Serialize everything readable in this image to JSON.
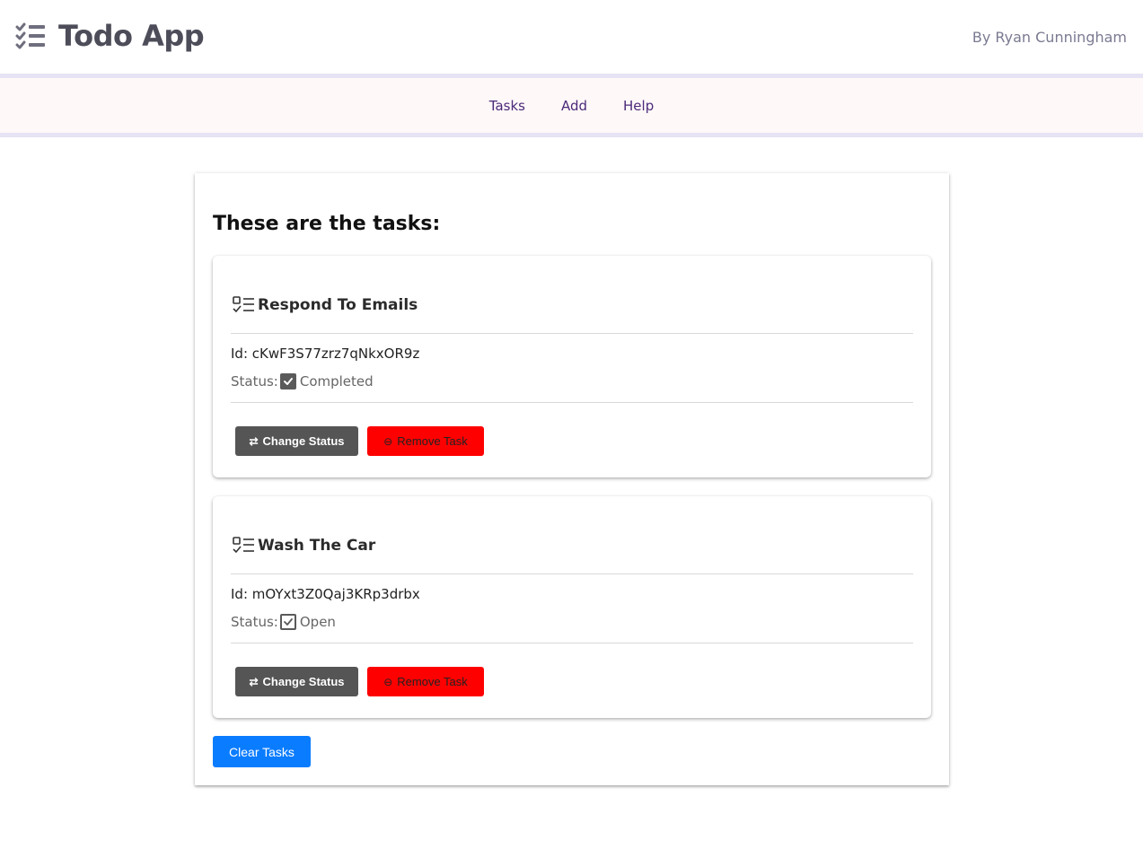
{
  "header": {
    "title": "Todo App",
    "author": "By Ryan Cunningham",
    "logo_icon": "checklist-icon"
  },
  "nav": {
    "items": [
      {
        "label": "Tasks"
      },
      {
        "label": "Add"
      },
      {
        "label": "Help"
      }
    ]
  },
  "main": {
    "heading": "These are the tasks:",
    "tasks": [
      {
        "name": "Respond To Emails",
        "id_label": "Id:",
        "id": "cKwF3S77zrz7qNkxOR9z",
        "status_label": "Status:",
        "status": "Completed",
        "status_icon": "checked-box-icon",
        "change_label": "Change Status",
        "remove_label": "Remove Task"
      },
      {
        "name": "Wash The Car",
        "id_label": "Id:",
        "id": "mOYxt3Z0Qaj3KRp3drbx",
        "status_label": "Status:",
        "status": "Open",
        "status_icon": "unchecked-box-icon",
        "change_label": "Change Status",
        "remove_label": "Remove Task"
      }
    ],
    "clear_label": "Clear Tasks"
  },
  "colors": {
    "nav_background": "#fff8f8",
    "nav_border": "#e6e3f5",
    "change_button": "#555555",
    "remove_button": "#ff0000",
    "clear_button": "#0a7cff",
    "nav_link": "#4b2a7a"
  }
}
